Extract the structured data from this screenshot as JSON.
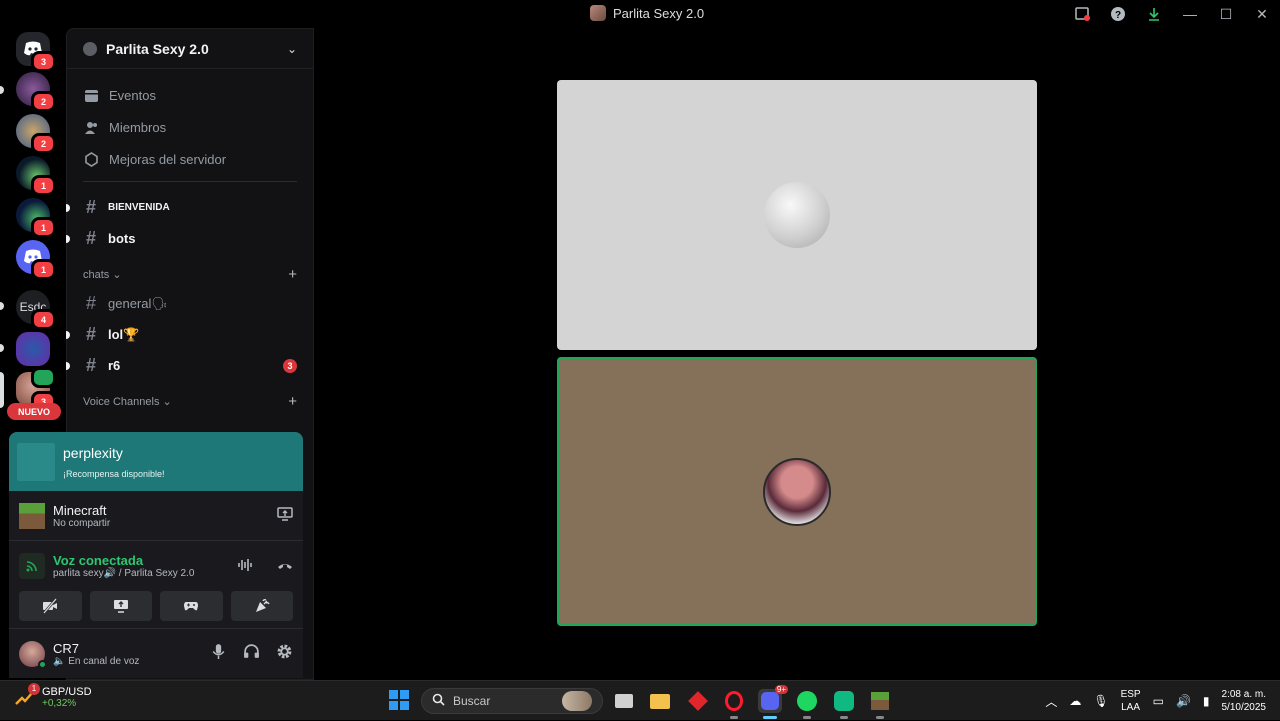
{
  "window": {
    "title": "Parlita Sexy 2.0"
  },
  "servers": [
    {
      "name": "discord-home",
      "badge": "3"
    },
    {
      "name": "server-1",
      "badge": "2"
    },
    {
      "name": "server-2",
      "badge": "2"
    },
    {
      "name": "server-3",
      "badge": "1"
    },
    {
      "name": "server-4",
      "badge": "1"
    },
    {
      "name": "server-5",
      "badge": "1"
    },
    {
      "name": "server-esdc",
      "label": "Esdc",
      "badge": "4"
    },
    {
      "name": "server-7",
      "badge": ""
    },
    {
      "name": "server-8",
      "badge": "3"
    }
  ],
  "new_label": "NUEVO",
  "sidebar": {
    "server_name": "Parlita Sexy 2.0",
    "nav": [
      {
        "label": "Eventos",
        "icon": "calendar-icon"
      },
      {
        "label": "Miembros",
        "icon": "members-icon"
      },
      {
        "label": "Mejoras del servidor",
        "icon": "boost-icon"
      }
    ],
    "channels_top": [
      {
        "name": "BIENVENIDA",
        "unread": true
      },
      {
        "name": "bots",
        "unread": true
      }
    ],
    "category_chats": "chats",
    "channels_chats": [
      {
        "name": "general",
        "emoji": "🗣",
        "unread": false
      },
      {
        "name": "lol",
        "emoji": "🏆",
        "unread": true
      },
      {
        "name": "r6",
        "emoji": "",
        "unread": true,
        "badge": "3"
      }
    ],
    "category_voice": "Voice Channels"
  },
  "panel": {
    "promo_title": "perplexity",
    "promo_sub": "¡Recompensa disponible!",
    "activity_name": "Minecraft",
    "activity_status": "No compartir",
    "voice_status": "Voz conectada",
    "voice_channel": "parlita sexy🔊 / Parlita Sexy 2.0",
    "username": "CR7",
    "user_status": "🔈 En canal de voz"
  },
  "taskbar": {
    "widget_title": "GBP/USD",
    "widget_value": "+0,32%",
    "widget_badge": "1",
    "search_placeholder": "Buscar",
    "discord_badge": "9+",
    "lang_top": "ESP",
    "lang_bottom": "LAA",
    "time": "2:08 a. m.",
    "date": "5/10/2025"
  },
  "colors": {
    "accent_green": "#23a559",
    "badge_red": "#f23f43",
    "promo_teal": "#1f7878",
    "tile_brown": "#85705a"
  }
}
